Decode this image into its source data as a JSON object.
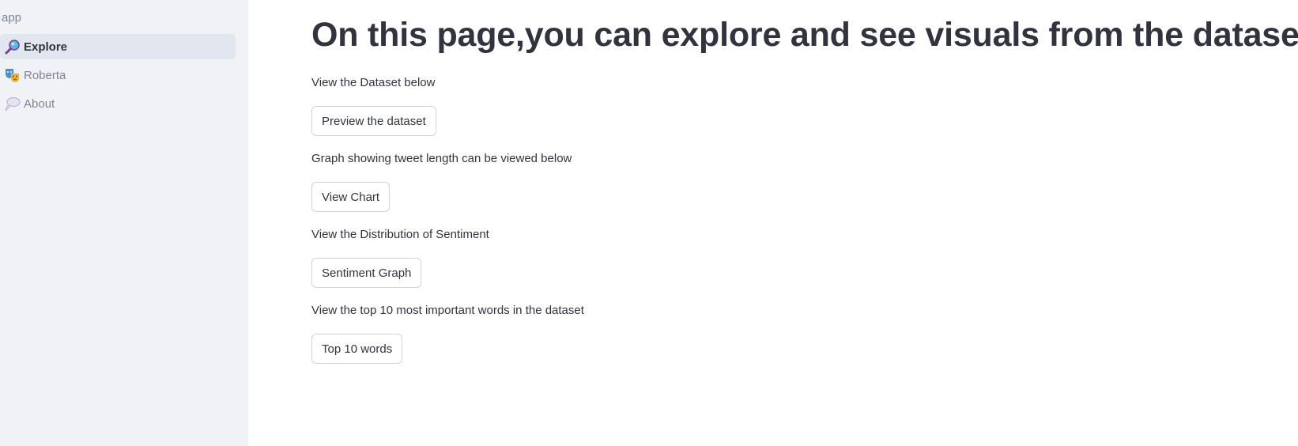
{
  "sidebar": {
    "app_label": "app",
    "items": [
      {
        "label": "Explore",
        "icon": "magnifier-icon",
        "active": true
      },
      {
        "label": "Roberta",
        "icon": "masks-icon",
        "active": false
      },
      {
        "label": "About",
        "icon": "speech-bubble-icon",
        "active": false
      }
    ]
  },
  "main": {
    "title": "On this page,you can explore and see visuals from the dataset",
    "sections": [
      {
        "caption": "View the Dataset below",
        "button": "Preview the dataset"
      },
      {
        "caption": "Graph showing tweet length can be viewed below",
        "button": "View Chart"
      },
      {
        "caption": "View the Distribution of Sentiment",
        "button": "Sentiment Graph"
      },
      {
        "caption": "View the top 10 most important words in the dataset",
        "button": "Top 10 words"
      }
    ]
  },
  "colors": {
    "sidebar_bg": "#f0f2f6",
    "active_item_bg": "#e2e6ee",
    "text": "#31333f",
    "muted_text": "#808495"
  }
}
